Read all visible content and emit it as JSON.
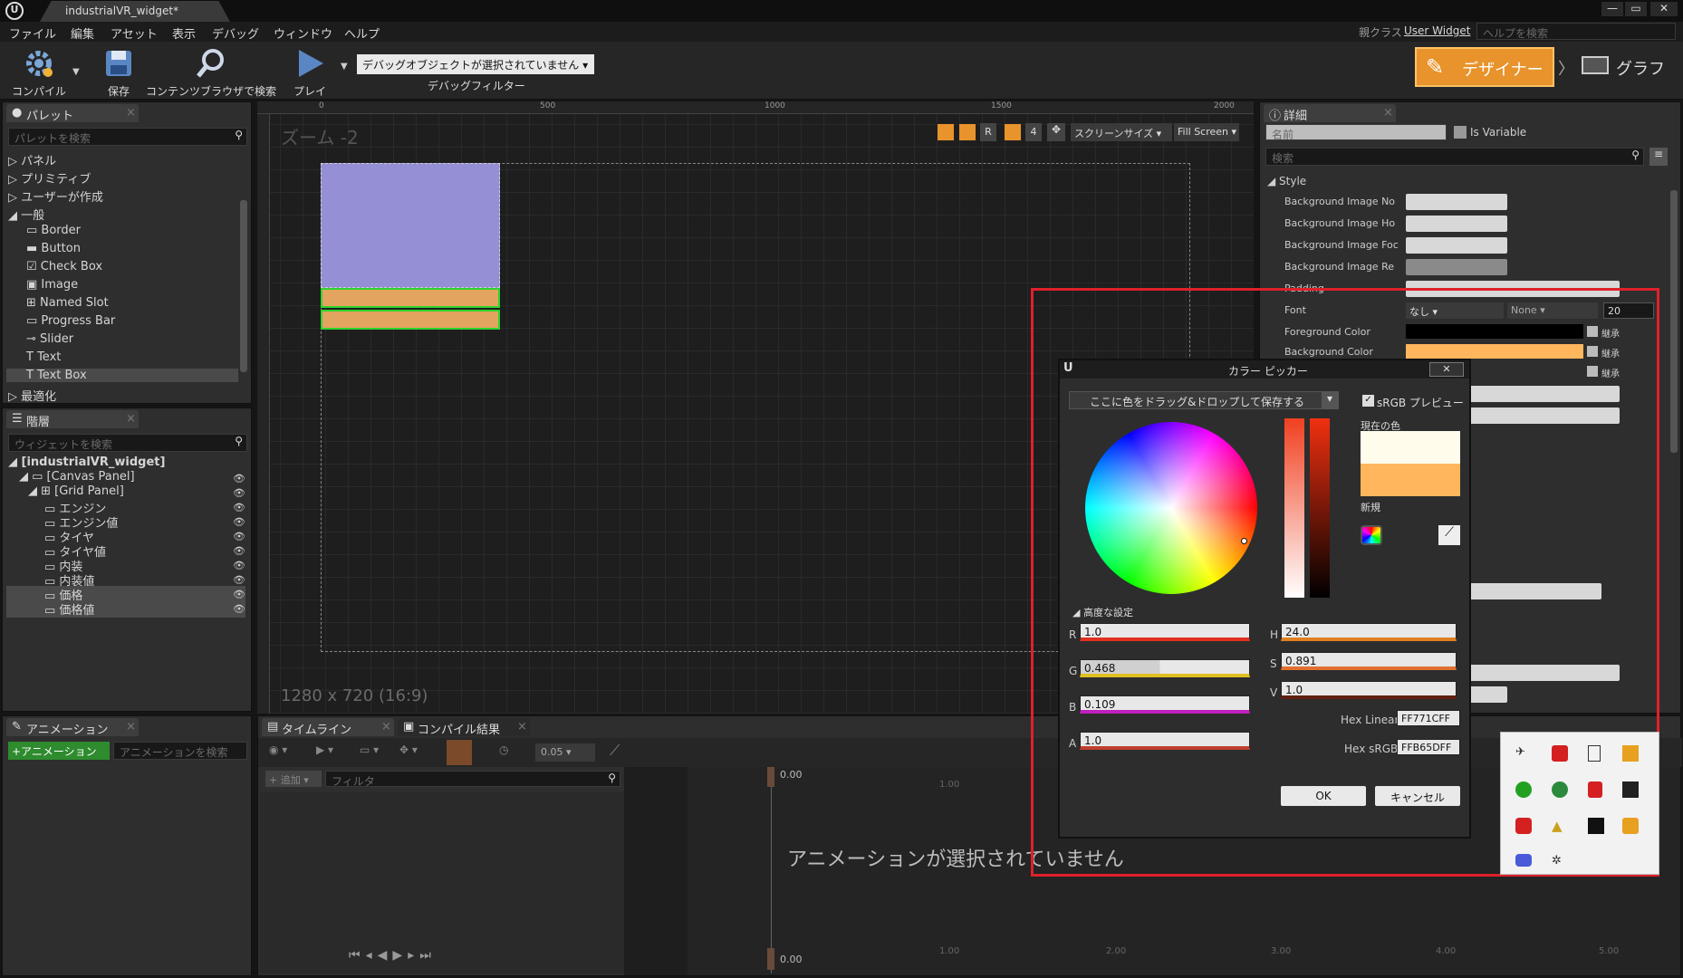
{
  "window": {
    "tab_title": "industrialVR_widget*",
    "parent_class_label": "親クラス",
    "parent_class": "User Widget",
    "help_search_placeholder": "ヘルプを検索"
  },
  "menu": [
    "ファイル",
    "編集",
    "アセット",
    "表示",
    "デバッグ",
    "ウィンドウ",
    "ヘルプ"
  ],
  "toolbar": {
    "compile": "コンパイル",
    "save": "保存",
    "browse": "コンテンツブラウザで検索",
    "play": "プレイ",
    "debug_select": "デバッグオブジェクトが選択されていません",
    "debug_filter": "デバッグフィルター",
    "designer": "デザイナー",
    "graph": "グラフ"
  },
  "palette": {
    "tab": "パレット",
    "search": "パレットを検索",
    "categories": [
      "パネル",
      "プリミティブ",
      "ユーザーが作成",
      "一般"
    ],
    "items": [
      "Border",
      "Button",
      "Check Box",
      "Image",
      "Named Slot",
      "Progress Bar",
      "Slider",
      "Text",
      "Text Box"
    ],
    "last": "最適化"
  },
  "hierarchy": {
    "tab": "階層",
    "search": "ウィジェットを検索",
    "items": [
      "[industrialVR_widget]",
      "[Canvas Panel]",
      "[Grid Panel]",
      "エンジン",
      "エンジン値",
      "タイヤ",
      "タイヤ値",
      "内装",
      "内装値",
      "価格",
      "価格値"
    ]
  },
  "canvas": {
    "zoom": "ズーム -2",
    "ruler": [
      "0",
      "500",
      "1000",
      "1500",
      "2000"
    ],
    "screen_size": "スクリーンサイズ",
    "fill": "Fill Screen",
    "resolution": "1280 x 720 (16:9)",
    "btn_r": "R",
    "btn_4": "4"
  },
  "details": {
    "tab": "詳細",
    "name_placeholder": "名前",
    "is_variable": "Is Variable",
    "search": "検索",
    "section": "Style",
    "rows": [
      "Background Image No",
      "Background Image Ho",
      "Background Image Foc",
      "Background Image Re",
      "Padding",
      "Font",
      "Foreground Color",
      "Background Color"
    ],
    "font_value": "なし",
    "font_face": "None",
    "font_size": "20",
    "inherit": "継承"
  },
  "picker": {
    "title": "カラー ピッカー",
    "drop_text": "ここに色をドラッグ&ドロップして保存する",
    "srgb": "sRGB プレビュー",
    "current": "現在の色",
    "new": "新規",
    "advanced": "高度な設定",
    "r": "1.0",
    "g": "0.468",
    "b": "0.109",
    "a": "1.0",
    "h": "24.0",
    "s": "0.891",
    "v": "1.0",
    "hex_linear_label": "Hex Linear",
    "hex_linear": "FF771CFF",
    "hex_srgb_label": "Hex sRGB",
    "hex_srgb": "FFB65DFF",
    "ok": "OK",
    "cancel": "キャンセル"
  },
  "animation": {
    "tab": "アニメーション",
    "add": "+アニメーション",
    "search": "アニメーションを検索"
  },
  "timeline": {
    "tab": "タイムライン",
    "compile_tab": "コンパイル結果",
    "add": "+ 追加",
    "filter": "フィルタ",
    "step": "0.05",
    "time": "0.00",
    "none": "アニメーションが選択されていません",
    "ticks": [
      "1.00",
      "2.00",
      "3.00",
      "4.00",
      "5.00"
    ]
  },
  "colors": {
    "accent": "#f5a623",
    "swatch_new": "#ffb65d",
    "widget_purple": "#9590d6",
    "widget_orange": "#e3a460",
    "highlight": "#e0202a"
  }
}
